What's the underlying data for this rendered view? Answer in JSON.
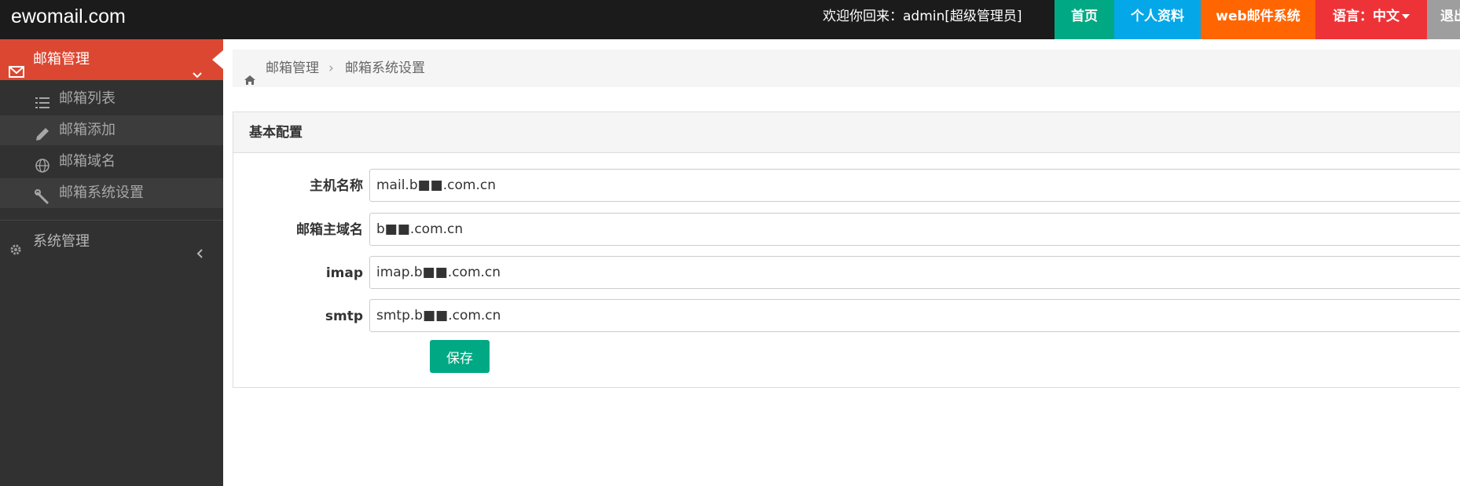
{
  "header": {
    "brand": "ewomail.com",
    "welcome": "欢迎你回来：admin[超级管理员]",
    "nav": {
      "home": "首页",
      "profile": "个人资料",
      "webmail": "web邮件系统",
      "language": "语言：中文",
      "logout": "退出"
    }
  },
  "sidebar": {
    "mail_section": {
      "label": "邮箱管理",
      "icon": "envelope-icon",
      "items": [
        {
          "label": "邮箱列表",
          "icon": "list-icon"
        },
        {
          "label": "邮箱添加",
          "icon": "pencil-icon"
        },
        {
          "label": "邮箱域名",
          "icon": "globe-icon"
        },
        {
          "label": "邮箱系统设置",
          "icon": "wrench-icon"
        }
      ]
    },
    "system_section": {
      "label": "系统管理",
      "icon": "gear-icon"
    }
  },
  "breadcrumb": {
    "items": [
      "邮箱管理",
      "邮箱系统设置"
    ],
    "separator": "›"
  },
  "panel": {
    "title": "基本配置",
    "fields": [
      {
        "label": "主机名称",
        "value": "mail.b■■.com.cn"
      },
      {
        "label": "邮箱主域名",
        "value": "b■■.com.cn"
      },
      {
        "label": "imap",
        "value": "imap.b■■.com.cn"
      },
      {
        "label": "smtp",
        "value": "smtp.b■■.com.cn"
      }
    ],
    "save_label": "保存"
  },
  "colors": {
    "topbar": "#1b1b1b",
    "sidebar": "#313131",
    "sidebar_active": "#dc4732",
    "home": "#00a983",
    "profile": "#04a7e8",
    "webmail": "#ff6500",
    "language": "#ee3338",
    "logout": "#9e9e9e",
    "save": "#00a983"
  }
}
